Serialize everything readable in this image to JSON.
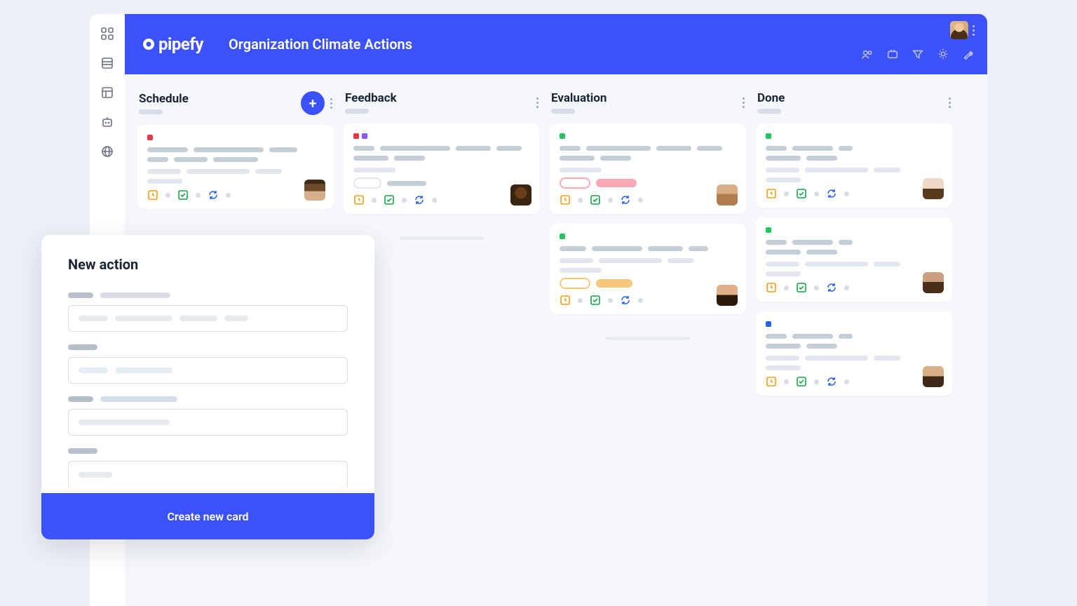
{
  "brand": "pipefy",
  "board_title": "Organization Climate Actions",
  "columns": [
    {
      "title": "Schedule",
      "add_button": true
    },
    {
      "title": "Feedback",
      "add_button": false
    },
    {
      "title": "Evaluation",
      "add_button": false
    },
    {
      "title": "Done",
      "add_button": false
    }
  ],
  "modal": {
    "title": "New action",
    "submit_label": "Create new card"
  }
}
